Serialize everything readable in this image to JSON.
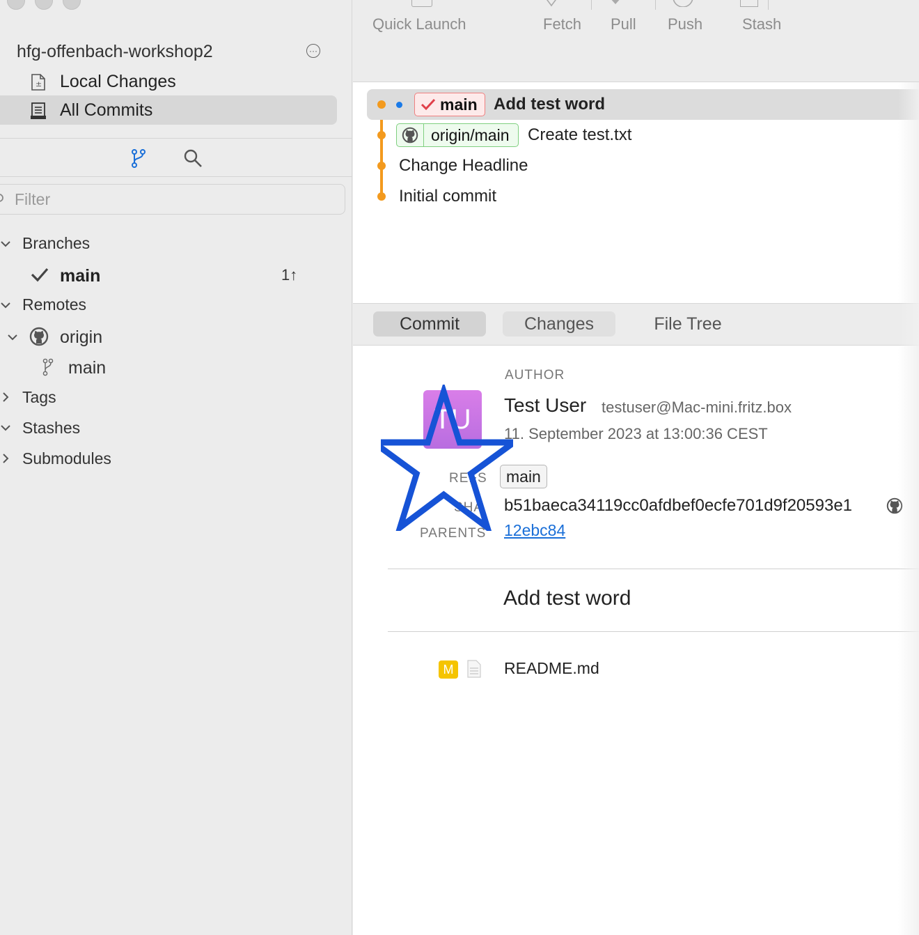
{
  "sidebar": {
    "repo_title": "hfg-offenbach-workshop2",
    "nav": [
      {
        "label": "Local Changes"
      },
      {
        "label": "All Commits"
      }
    ],
    "filter_placeholder": "Filter",
    "tree": {
      "branches_label": "Branches",
      "branch_main": "main",
      "ahead": "1↑",
      "remotes_label": "Remotes",
      "origin_label": "origin",
      "remote_main": "main",
      "tags_label": "Tags",
      "stashes_label": "Stashes",
      "submodules_label": "Submodules"
    }
  },
  "toolbar": {
    "quick_launch": "Quick Launch",
    "fetch": "Fetch",
    "pull": "Pull",
    "push": "Push",
    "stash": "Stash"
  },
  "commits": [
    {
      "tag": "main",
      "message": "Add test word"
    },
    {
      "tag": "origin/main",
      "message": "Create test.txt"
    },
    {
      "message": "Change Headline"
    },
    {
      "message": "Initial commit"
    }
  ],
  "tabs": {
    "commit": "Commit",
    "changes": "Changes",
    "file_tree": "File Tree"
  },
  "detail": {
    "author_label": "AUTHOR",
    "author_name": "Test User",
    "author_email": "testuser@Mac-mini.fritz.box",
    "date": "11. September 2023 at 13:00:36 CEST",
    "avatar_initials": "TU",
    "refs_label": "REFS",
    "ref": "main",
    "sha_label": "SHA",
    "sha": "b51baeca34119cc0afdbef0ecfe701d9f20593e1",
    "parents_label": "PARENTS",
    "parent": "12ebc84",
    "message": "Add test word",
    "files": [
      {
        "status": "M",
        "name": "README.md"
      }
    ]
  },
  "colors": {
    "graph": "#f39a1e",
    "star": "#1653d6",
    "link": "#1a6fd8",
    "modified": "#f5c400"
  }
}
